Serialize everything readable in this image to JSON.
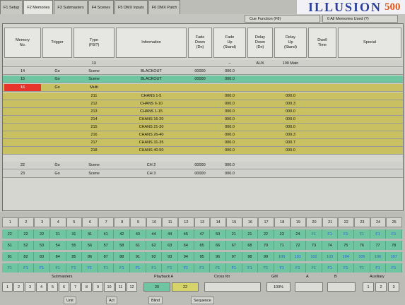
{
  "tabs": [
    "F1 Setup",
    "F2 Memories",
    "F3 Submasters",
    "F4 Scenes",
    "F5 DMX Inputs",
    "F6 DMX Patch"
  ],
  "brand": {
    "name": "ILLUSION",
    "model": "500"
  },
  "subtabs": {
    "cues": "Cue Function (F8)",
    "memories": "0 All Memories Used (?)"
  },
  "columns": [
    "Memory\nNo.",
    "Trigger",
    "Type\n(F8/?)",
    "Information",
    "Fade\nDown\n(Dn)",
    "Fade\nUp\n(Stand)",
    "Delay\nDown\n(Dn)",
    "Delay\nUp\n(Stand)",
    "Dwell\nTime",
    "Special"
  ],
  "rows": [
    {
      "style": "gray",
      "no": "",
      "trigger": "",
      "type": "1X",
      "info": "",
      "fd": "",
      "fu": "--",
      "dd": "AUX",
      "du": "100 Main",
      "dw": "",
      "sp": ""
    },
    {
      "style": "gray",
      "no": "14",
      "trigger": "Go",
      "type": "Scene",
      "info": "BLACKOUT",
      "fd": "00000",
      "fu": "000.0",
      "dd": "",
      "du": "",
      "dw": "",
      "sp": ""
    },
    {
      "style": "green",
      "no": "15",
      "trigger": "Go",
      "type": "Scene",
      "info": "BLACKOUT",
      "fd": "00000",
      "fu": "000.0",
      "dd": "",
      "du": "",
      "dw": "",
      "sp": ""
    },
    {
      "style": "yellow",
      "no": "16",
      "trigger": "Go",
      "type": "Multi",
      "info": "",
      "fd": "",
      "fu": "",
      "dd": "",
      "du": "",
      "dw": "",
      "sp": ""
    },
    {
      "style": "yellow",
      "no": "",
      "trigger": "",
      "type": "211",
      "info": "CHANS 1-5",
      "fd": "",
      "fu": "000.0",
      "dd": "",
      "du": "000.0",
      "dw": "",
      "sp": ""
    },
    {
      "style": "yellow",
      "no": "",
      "trigger": "",
      "type": "212",
      "info": "CHANS 6-10",
      "fd": "",
      "fu": "000.0",
      "dd": "",
      "du": "000.3",
      "dw": "",
      "sp": ""
    },
    {
      "style": "yellow",
      "no": "",
      "trigger": "",
      "type": "213",
      "info": "CHANS 1-15",
      "fd": "",
      "fu": "000.0",
      "dd": "",
      "du": "000.0",
      "dw": "",
      "sp": ""
    },
    {
      "style": "yellow",
      "no": "",
      "trigger": "",
      "type": "214",
      "info": "CHANS 16-20",
      "fd": "",
      "fu": "000.0",
      "dd": "",
      "du": "000.0",
      "dw": "",
      "sp": ""
    },
    {
      "style": "yellow",
      "no": "",
      "trigger": "",
      "type": "215",
      "info": "CHANS 21-30",
      "fd": "",
      "fu": "000.0",
      "dd": "",
      "du": "000.0",
      "dw": "",
      "sp": ""
    },
    {
      "style": "yellow",
      "no": "",
      "trigger": "",
      "type": "216",
      "info": "CHANS 26-40",
      "fd": "",
      "fu": "000.0",
      "dd": "",
      "du": "000.3",
      "dw": "",
      "sp": ""
    },
    {
      "style": "yellow",
      "no": "",
      "trigger": "",
      "type": "217",
      "info": "CHANS 31-35",
      "fd": "",
      "fu": "000.0",
      "dd": "",
      "du": "000.7",
      "dw": "",
      "sp": ""
    },
    {
      "style": "yellow",
      "no": "",
      "trigger": "",
      "type": "218",
      "info": "CHANS 40-50",
      "fd": "",
      "fu": "000.0",
      "dd": "",
      "du": "000.0",
      "dw": "",
      "sp": ""
    },
    {
      "style": "gray",
      "no": "22",
      "trigger": "Go",
      "type": "Scene",
      "info": "CH 2",
      "fd": "00000",
      "fu": "000.0",
      "dd": "",
      "du": "",
      "dw": "",
      "sp": ""
    },
    {
      "style": "gray",
      "no": "23",
      "trigger": "Go",
      "type": "Scene",
      "info": "CH 3",
      "fd": "00000",
      "fu": "000.0",
      "dd": "",
      "du": "",
      "dw": "",
      "sp": ""
    }
  ],
  "channels": [
    "1",
    "2",
    "3",
    "4",
    "5",
    "6",
    "7",
    "8",
    "9",
    "10",
    "11",
    "12",
    "13",
    "14",
    "15",
    "16",
    "17",
    "18",
    "19",
    "20",
    "21",
    "22",
    "23",
    "24",
    "25"
  ],
  "levels": [
    [
      "22",
      "22",
      "22",
      "31",
      "31",
      "41",
      "41",
      "42",
      "43",
      "44",
      "44",
      "45",
      "47",
      "50",
      "21",
      "21",
      "22",
      "23",
      "24",
      "F1",
      "F1",
      "F1",
      "F1",
      "F1",
      "F1"
    ],
    [
      "51",
      "52",
      "53",
      "54",
      "55",
      "56",
      "57",
      "58",
      "61",
      "62",
      "63",
      "64",
      "65",
      "66",
      "67",
      "68",
      "70",
      "71",
      "72",
      "73",
      "74",
      "75",
      "76",
      "77",
      "78"
    ],
    [
      "81",
      "82",
      "83",
      "84",
      "85",
      "86",
      "87",
      "88",
      "91",
      "92",
      "93",
      "94",
      "95",
      "96",
      "97",
      "98",
      "99",
      "100",
      "101",
      "102",
      "103",
      "104",
      "105",
      "106",
      "107"
    ],
    [
      "F1",
      "F1",
      "F1",
      "F1",
      "F1",
      "F1",
      "F1",
      "F1",
      "F1",
      "F1",
      "F1",
      "F1",
      "F1",
      "F1",
      "F1",
      "F1",
      "F1",
      "F1",
      "F1",
      "F1",
      "F1",
      "F1",
      "F1",
      "F1",
      "F1"
    ]
  ],
  "status_labels": {
    "submasters": "Submasters",
    "playback": "Playback A",
    "crossfader": "Cross fdr",
    "grand": "GM",
    "a": "A",
    "b": "B",
    "auxiliary": "Auxiliary"
  },
  "status": {
    "subs": [
      "1",
      "2",
      "3",
      "4",
      "5",
      "6",
      "7",
      "8",
      "9",
      "10",
      "11",
      "12"
    ],
    "pb_a": "20",
    "pb_b": "22",
    "gm": "100%",
    "aux": [
      "1",
      "2",
      "3"
    ]
  },
  "infobar": [
    "Unit",
    "Act",
    "Blind",
    "Sequence"
  ]
}
